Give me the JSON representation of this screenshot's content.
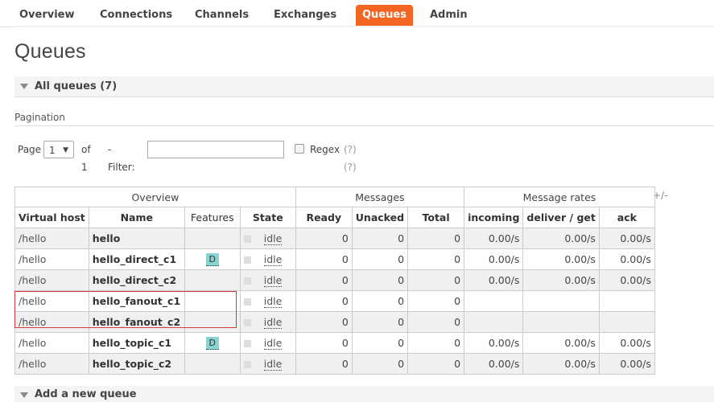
{
  "nav": {
    "tabs": [
      {
        "label": "Overview"
      },
      {
        "label": "Connections"
      },
      {
        "label": "Channels"
      },
      {
        "label": "Exchanges"
      },
      {
        "label": "Queues",
        "active": true
      },
      {
        "label": "Admin"
      }
    ]
  },
  "page_title": "Queues",
  "section": {
    "title": "All queues (7)"
  },
  "pagination": {
    "label": "Pagination",
    "page_label": "Page",
    "page_value": "1",
    "of_label": "of 1",
    "filter_label": "- Filter:",
    "filter_value": "",
    "regex_label": "Regex",
    "regex_help": "(?)(?)"
  },
  "table": {
    "groups": [
      "Overview",
      "Messages",
      "Message rates"
    ],
    "plus_minus": "+/-",
    "columns": [
      "Virtual host",
      "Name",
      "Features",
      "State",
      "Ready",
      "Unacked",
      "Total",
      "incoming",
      "deliver / get",
      "ack"
    ],
    "rows": [
      {
        "vhost": "/hello",
        "name": "hello",
        "feature": "",
        "state": "idle",
        "ready": "0",
        "unacked": "0",
        "total": "0",
        "incoming": "0.00/s",
        "deliver": "0.00/s",
        "ack": "0.00/s"
      },
      {
        "vhost": "/hello",
        "name": "hello_direct_c1",
        "feature": "D",
        "state": "idle",
        "ready": "0",
        "unacked": "0",
        "total": "0",
        "incoming": "0.00/s",
        "deliver": "0.00/s",
        "ack": "0.00/s"
      },
      {
        "vhost": "/hello",
        "name": "hello_direct_c2",
        "feature": "",
        "state": "idle",
        "ready": "0",
        "unacked": "0",
        "total": "0",
        "incoming": "0.00/s",
        "deliver": "0.00/s",
        "ack": "0.00/s"
      },
      {
        "vhost": "/hello",
        "name": "hello_fanout_c1",
        "feature": "",
        "state": "idle",
        "ready": "0",
        "unacked": "0",
        "total": "0",
        "incoming": "",
        "deliver": "",
        "ack": ""
      },
      {
        "vhost": "/hello",
        "name": "hello_fanout_c2",
        "feature": "",
        "state": "idle",
        "ready": "0",
        "unacked": "0",
        "total": "0",
        "incoming": "",
        "deliver": "",
        "ack": ""
      },
      {
        "vhost": "/hello",
        "name": "hello_topic_c1",
        "feature": "D",
        "state": "idle",
        "ready": "0",
        "unacked": "0",
        "total": "0",
        "incoming": "0.00/s",
        "deliver": "0.00/s",
        "ack": "0.00/s"
      },
      {
        "vhost": "/hello",
        "name": "hello_topic_c2",
        "feature": "",
        "state": "idle",
        "ready": "0",
        "unacked": "0",
        "total": "0",
        "incoming": "0.00/s",
        "deliver": "0.00/s",
        "ack": "0.00/s"
      }
    ]
  },
  "add_queue": {
    "title": "Add a new queue"
  },
  "colors": {
    "accent": "#f26522",
    "badge": "#88d4d0",
    "highlight_border": "#d23c3c"
  }
}
